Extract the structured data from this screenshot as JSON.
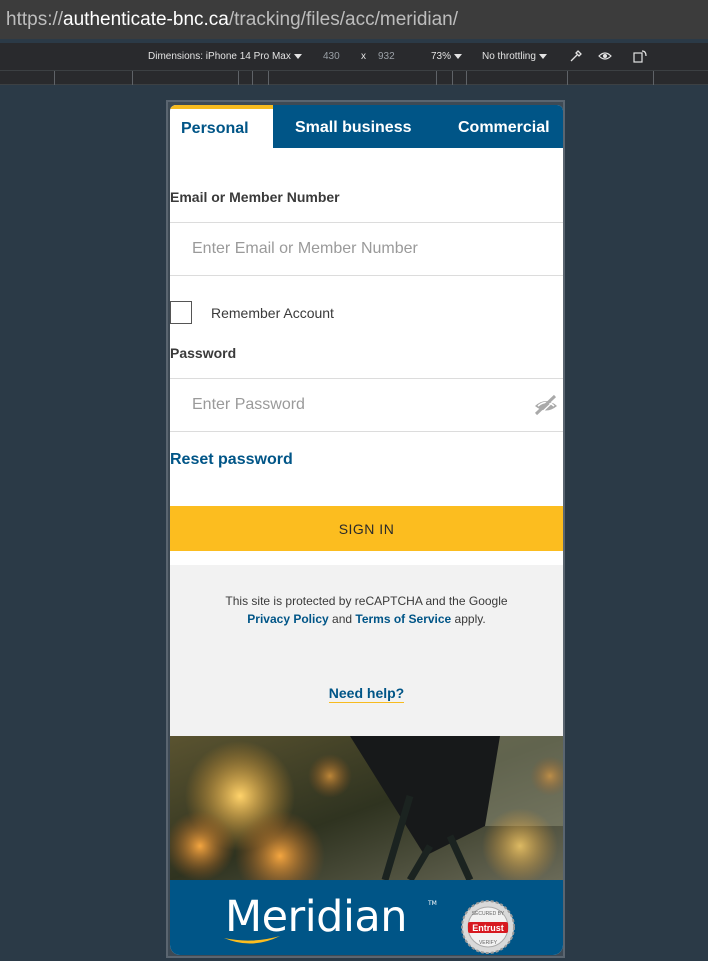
{
  "browser": {
    "url_prefix": "https://",
    "url_host": "authenticate-bnc.ca",
    "url_path": "/tracking/files/acc/meridian/"
  },
  "devtools": {
    "dimensions_label": "Dimensions: iPhone 14 Pro Max",
    "width": "430",
    "times": "x",
    "height": "932",
    "zoom": "73%",
    "throttling": "No throttling"
  },
  "tabs": {
    "personal": "Personal",
    "small_business": "Small business",
    "commercial": "Commercial"
  },
  "form": {
    "email_label": "Email or Member Number",
    "email_placeholder": "Enter Email or Member Number",
    "remember_label": "Remember Account",
    "password_label": "Password",
    "password_placeholder": "Enter Password",
    "reset_link": "Reset password",
    "signin_button": "SIGN IN"
  },
  "recaptcha": {
    "text_1": "This site is protected by reCAPTCHA and the Google ",
    "privacy_link": "Privacy Policy",
    "text_2": " and ",
    "terms_link": "Terms of Service",
    "text_3": " apply."
  },
  "help": {
    "need_help": "Need help?"
  },
  "footer": {
    "brand": "Meridian",
    "trademark": "TM",
    "seal_top": "SECURED BY",
    "seal_brand": "Entrust",
    "seal_bottom": "VERIFY"
  },
  "colors": {
    "brand_blue": "#005587",
    "accent_yellow": "#fcbd1f"
  },
  "icons": {
    "password_toggle": "eye-slash-icon",
    "devtools_picker": "eyedropper-icon",
    "devtools_vision": "eye-icon",
    "devtools_rotate": "rotate-icon"
  }
}
